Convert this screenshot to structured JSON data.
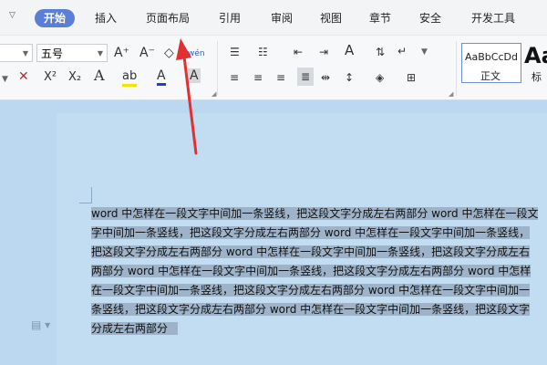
{
  "ribbon": {
    "menu_caret": "▽",
    "tabs": [
      "开始",
      "插入",
      "页面布局",
      "引用",
      "审阅",
      "视图",
      "章节",
      "安全",
      "开发工具"
    ],
    "active_tab": "开始"
  },
  "toolbar": {
    "font_size": "五号",
    "grow_font": "A⁺",
    "shrink_font": "A⁻",
    "clear_format": "◇",
    "phonetic": "wén",
    "superscript": "X²",
    "subscript": "X₂",
    "text_effect": "A",
    "highlight": "ab",
    "font_color": "A",
    "char_shade": "A",
    "highlight_color": "#f5e400",
    "font_color_value": "#2040d0"
  },
  "styles": {
    "normal_sample": "AaBbCcDd",
    "normal_label": "正文",
    "title_sample": "Aa",
    "title_label": "标"
  },
  "document": {
    "lines": [
      "word 中怎样在一段文字中间加一条竖线，把这段文字分成左右两部分 word 中怎样在一段文",
      "字中间加一条竖线，把这段文字分成左右两部分 word 中怎样在一段文字中间加一条竖线，",
      "把这段文字分成左右两部分 word 中怎样在一段文字中间加一条竖线，把这段文字分成左右",
      "两部分 word 中怎样在一段文字中间加一条竖线，把这段文字分成左右两部分 word 中怎样",
      "在一段文字中间加一条竖线，把这段文字分成左右两部分 word 中怎样在一段文字中间加一",
      "条竖线，把这段文字分成左右两部分 word 中怎样在一段文字中间加一条竖线，把这段文字",
      "分成左右两部分"
    ]
  },
  "annotation": {
    "arrow_color": "#e03030"
  }
}
